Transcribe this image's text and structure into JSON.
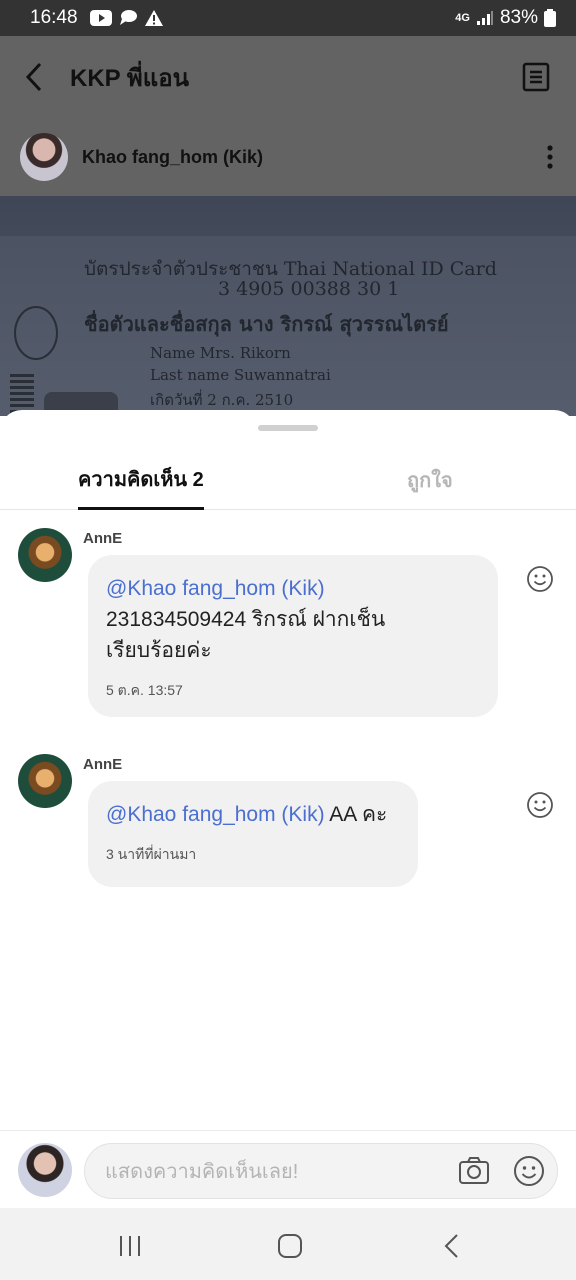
{
  "status_bar": {
    "time": "16:48",
    "network": "4G",
    "battery": "83%"
  },
  "header": {
    "title": "KKP พี่แอน"
  },
  "post": {
    "author": "Khao fang_hom (Kik)",
    "image_text": {
      "line1": "บัตรประจำตัวประชาชน Thai National ID Card",
      "id_number": "3 4905 00388 30 1",
      "name_th": "ชื่อตัวและชื่อสกุล นาง ริกรณ์ สุวรรณไตรย์",
      "name_en": "Name Mrs. Rikorn",
      "lastname_en": "Last name Suwannatrai",
      "dob": "เกิดวันที่ 2 ก.ค. 2510"
    }
  },
  "tabs": {
    "comments": "ความคิดเห็น 2",
    "likes": "ถูกใจ"
  },
  "comments": [
    {
      "user": "AnnE",
      "mention": "@Khao fang_hom (Kik)",
      "line1": "231834509424 ริกรณ์ ฝากเช็น",
      "line2": "เรียบร้อยค่ะ",
      "time": "5 ต.ค. 13:57"
    },
    {
      "user": "AnnE",
      "mention": "@Khao fang_hom (Kik)",
      "rest": " AA คะ",
      "time": "3 นาทีที่ผ่านมา"
    }
  ],
  "input": {
    "placeholder": "แสดงความคิดเห็นเลย!"
  }
}
